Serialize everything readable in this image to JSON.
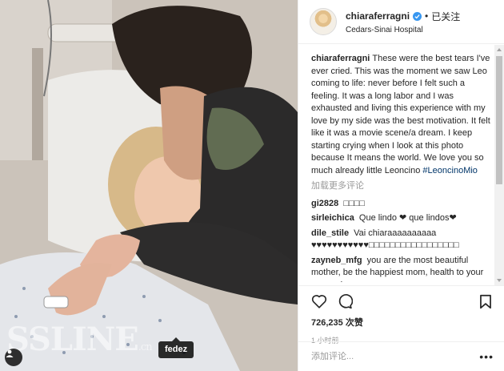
{
  "photo": {
    "tag_label": "fedez",
    "watermark": "SSLINE",
    "watermark_small": ".cn"
  },
  "header": {
    "username": "chiaraferragni",
    "separator": "•",
    "follow_state": "已关注",
    "location": "Cedars-Sinai Hospital"
  },
  "caption": {
    "username": "chiaraferragni",
    "text": "These were the best tears I've ever cried. This was the moment we saw Leo coming to life: never before I felt such a feeling. It was a long labor and I was exhausted and living this experience with my love by my side was the best motivation. It felt like it was a movie scene/a dream. I keep starting crying when I look at this photo because It means the world. We love you so much already little Leoncino ",
    "hashtag": "#LeoncinoMio"
  },
  "load_more": "加载更多评论",
  "comments": [
    {
      "username": "gi2828",
      "text": "□□□□"
    },
    {
      "username": "sirleichica",
      "text": "Que lindo ❤ que lindos❤"
    },
    {
      "username": "dile_stile",
      "text": "Vai chiaraaaaaaaaaa ♥♥♥♥♥♥♥♥♥♥♥□□□□□□□□□□□□□□□□□"
    },
    {
      "username": "zayneb_mfg",
      "text": "you are the most beautiful mother, be the happiest mom, health to your son and you □□□"
    }
  ],
  "actions": {
    "likes": "726,235 次赞",
    "time": "1 小时前"
  },
  "add_comment": {
    "placeholder": "添加评论...",
    "more": "•••"
  },
  "icons": {
    "verified": "verified-badge-icon",
    "heart": "heart-icon",
    "comment": "comment-icon",
    "bookmark": "bookmark-icon",
    "user_tag": "user-tag-icon"
  },
  "colors": {
    "hashtag": "#003569",
    "verified": "#3897f0",
    "muted": "#999999",
    "border": "#efefef"
  }
}
